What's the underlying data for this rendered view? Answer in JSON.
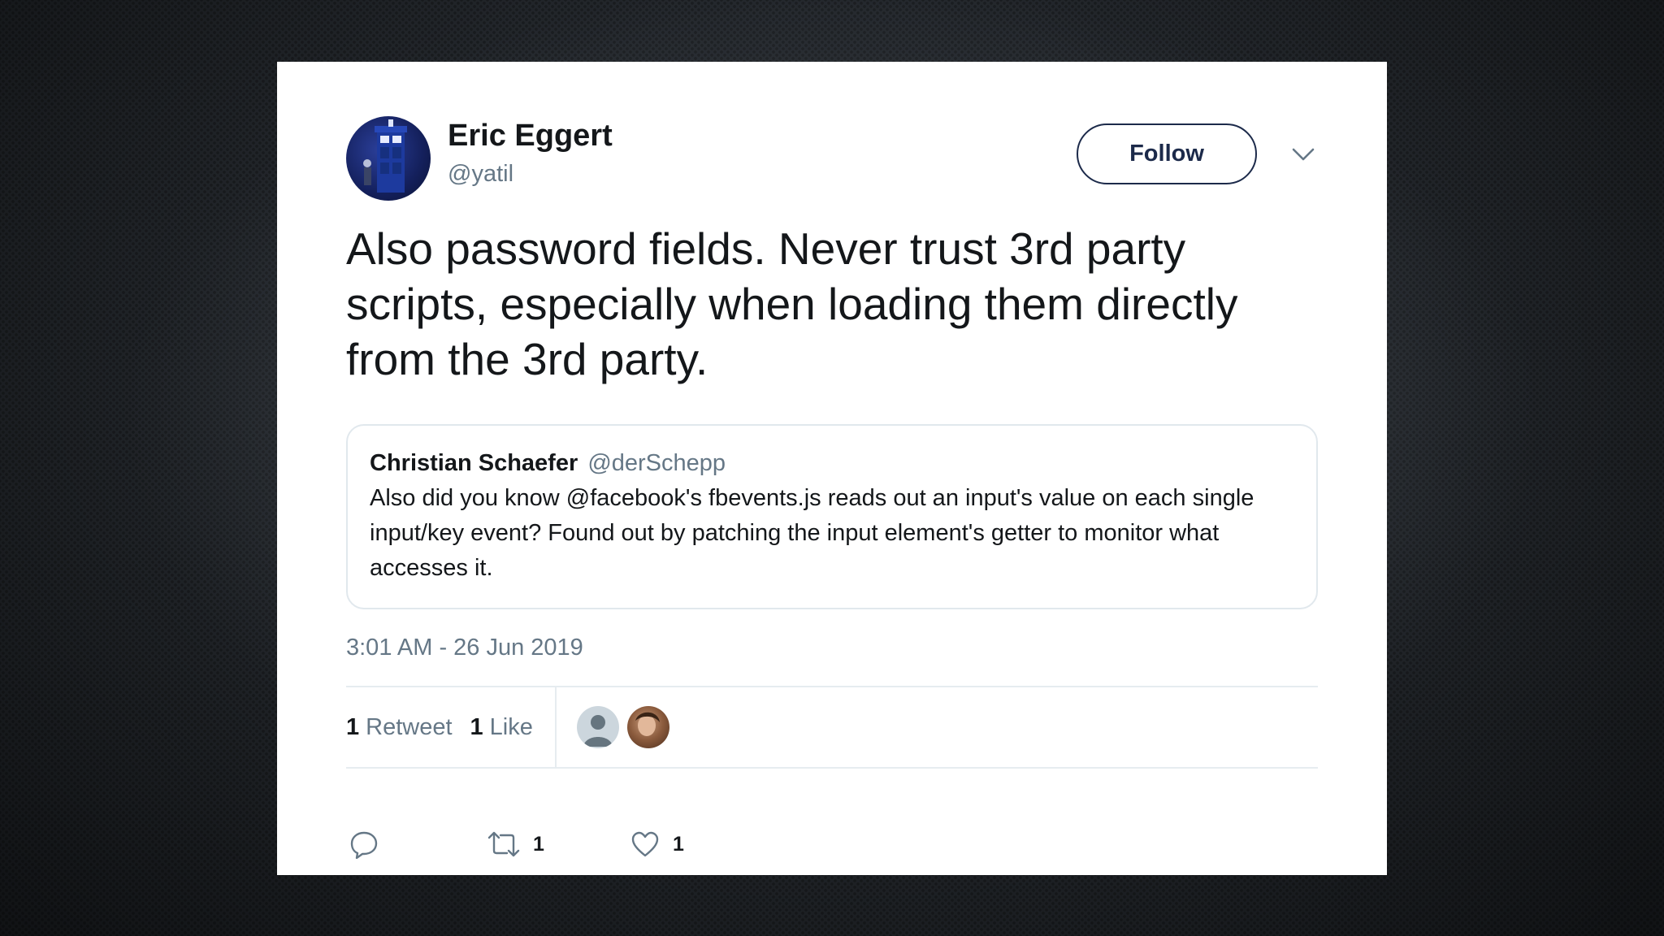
{
  "tweet": {
    "author": {
      "name": "Eric Eggert",
      "handle": "@yatil"
    },
    "follow_label": "Follow",
    "text": "Also password fields. Never trust 3rd party scripts, especially when loading them directly from the 3rd party.",
    "quoted": {
      "name": "Christian Schaefer",
      "handle": "@derSchepp",
      "text": "Also did you know @facebook's fbevents.js reads out an input's value on each single input/key event? Found out by patching the input element's getter to monitor what accesses it."
    },
    "timestamp": "3:01 AM - 26 Jun 2019",
    "stats": {
      "retweet_count": "1",
      "retweet_label": "Retweet",
      "like_count": "1",
      "like_label": "Like"
    },
    "actions": {
      "reply_icon": "reply-icon",
      "retweet_icon": "retweet-icon",
      "retweet_count": "1",
      "like_icon": "heart-icon",
      "like_count": "1"
    }
  },
  "colors": {
    "text_primary": "#14171a",
    "text_secondary": "#657786",
    "follow_border": "#1c2a4a",
    "divider": "#e6ecf0"
  }
}
